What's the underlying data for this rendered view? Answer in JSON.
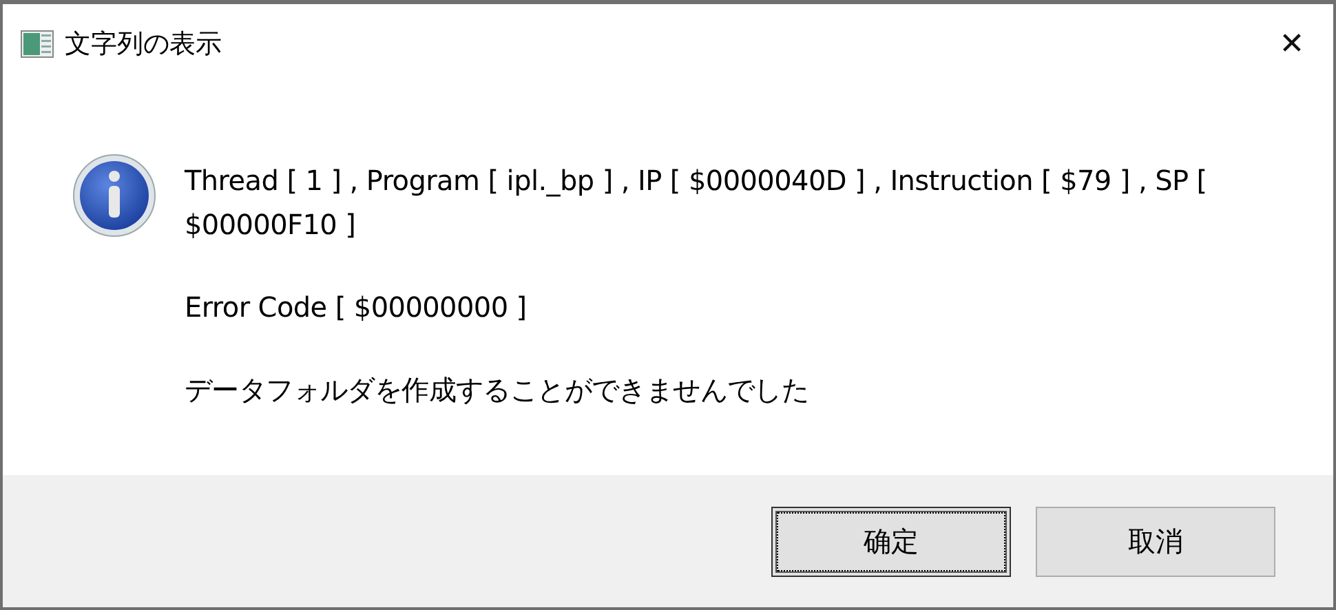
{
  "window": {
    "title": "文字列の表示",
    "close": "✕"
  },
  "message": {
    "paragraphs": [
      "Thread [ 1 ] , Program [ ipl._bp ] , IP [ $0000040D ] , Instruction [ $79 ] , SP [ $00000F10 ]",
      "Error Code [ $00000000 ]",
      "データフォルダを作成することができませんでした"
    ]
  },
  "buttons": [
    {
      "label": "确定",
      "focused": true
    },
    {
      "label": "取消",
      "focused": false
    }
  ]
}
